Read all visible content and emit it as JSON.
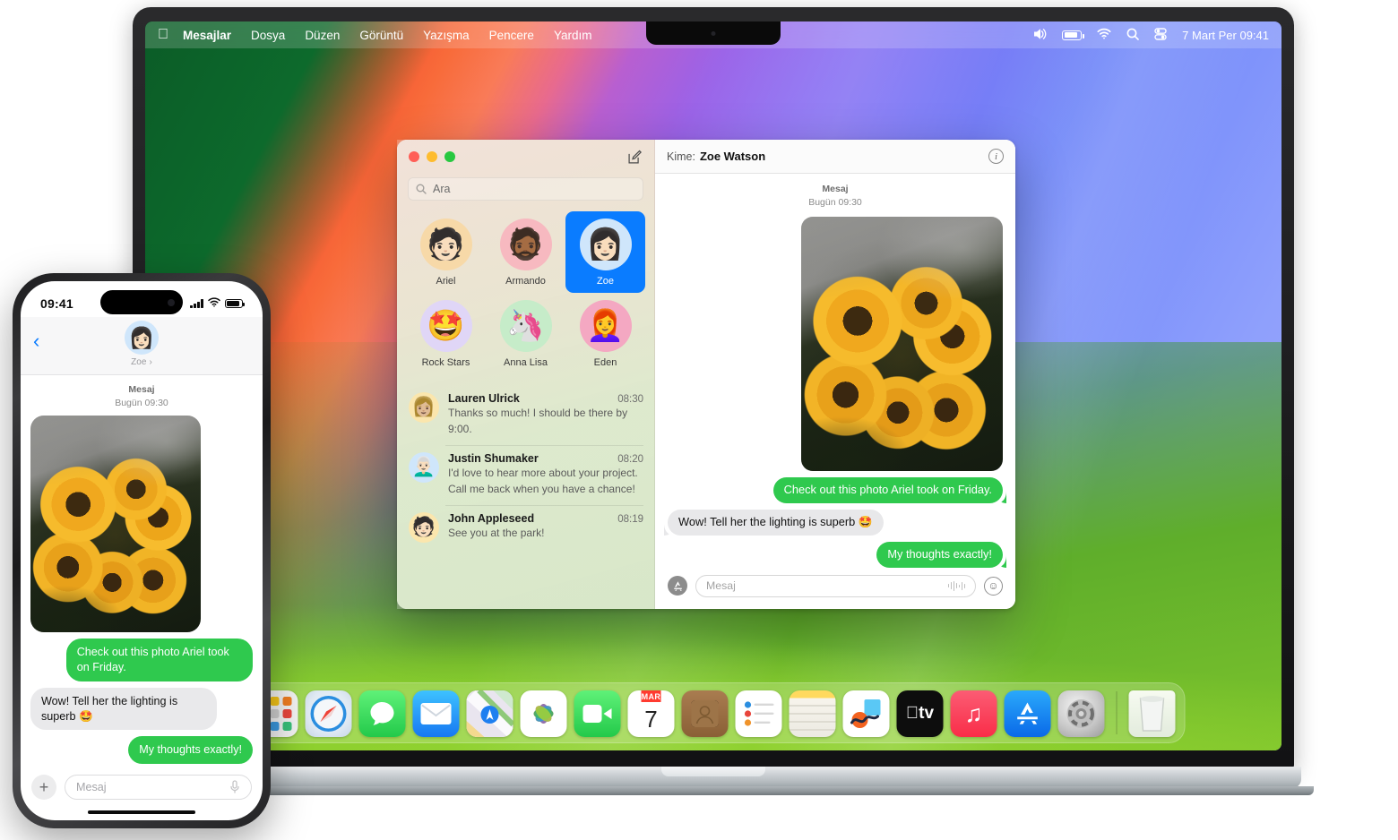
{
  "menubar": {
    "apple_icon": "apple-icon",
    "items": [
      {
        "label": "Mesajlar",
        "bold": true
      },
      {
        "label": "Dosya",
        "bold": false
      },
      {
        "label": "Düzen",
        "bold": false
      },
      {
        "label": "Görüntü",
        "bold": false
      },
      {
        "label": "Yazışma",
        "bold": false
      },
      {
        "label": "Pencere",
        "bold": false
      },
      {
        "label": "Yardım",
        "bold": false
      }
    ],
    "status_icons": [
      "volume-icon",
      "battery-icon",
      "wifi-icon",
      "search-icon",
      "control-center-icon"
    ],
    "clock": "7 Mart Per  09:41"
  },
  "messages_window": {
    "traffic_lights": [
      "close-button",
      "minimize-button",
      "zoom-button"
    ],
    "compose_icon": "compose-icon",
    "search": {
      "placeholder": "Ara",
      "icon": "search-icon"
    },
    "pinned": [
      {
        "name": "Ariel",
        "emoji": "🧑🏻",
        "bg": "#f7d9a8",
        "selected": false
      },
      {
        "name": "Armando",
        "emoji": "🧔🏾",
        "bg": "#f7b9c0",
        "selected": false
      },
      {
        "name": "Zoe",
        "emoji": "👩🏻",
        "bg": "#cfe6fb",
        "selected": true
      },
      {
        "name": "Rock Stars",
        "emoji": "🤩",
        "bg": "#e0d6f7",
        "selected": false
      },
      {
        "name": "Anna Lisa",
        "emoji": "🦄",
        "bg": "#c6ecc9",
        "selected": false
      },
      {
        "name": "Eden",
        "emoji": "👩‍🦰",
        "bg": "#f4a8c2",
        "selected": false
      }
    ],
    "conversations": [
      {
        "name": "Lauren Ulrick",
        "time": "08:30",
        "preview": "Thanks so much! I should be there by 9:00.",
        "emoji": "👩🏼",
        "bg": "#fbe6ad"
      },
      {
        "name": "Justin Shumaker",
        "time": "08:20",
        "preview": "I'd love to hear more about your project.\nCall me back when you have a chance!",
        "emoji": "👨🏻‍🦳",
        "bg": "#cfe6fb"
      },
      {
        "name": "John Appleseed",
        "time": "08:19",
        "preview": "See you at the park!",
        "emoji": "🧑🏻",
        "bg": "#fbe6ad"
      }
    ],
    "header": {
      "to_label": "Kime:",
      "recipient": "Zoe Watson",
      "info_icon": "info-icon"
    },
    "thread": {
      "service": "Mesaj",
      "timestamp": "Bugün 09:30",
      "attachment_alt": "sunflowers-photo",
      "messages": [
        {
          "text": "Check out this photo Ariel took on Friday.",
          "side": "out"
        },
        {
          "text": "Wow! Tell her the lighting is superb 🤩",
          "side": "in"
        },
        {
          "text": "My thoughts exactly!",
          "side": "out"
        }
      ]
    },
    "composer": {
      "apps_icon": "app-store-icon",
      "placeholder": "Mesaj",
      "audio_icon": "audio-waveform-icon",
      "emoji_icon": "emoji-icon"
    }
  },
  "dock": {
    "items": [
      {
        "name": "launchpad",
        "label": "Launchpad"
      },
      {
        "name": "safari",
        "label": "Safari"
      },
      {
        "name": "messages",
        "label": "Mesajlar"
      },
      {
        "name": "mail",
        "label": "Mail"
      },
      {
        "name": "maps",
        "label": "Haritalar"
      },
      {
        "name": "photos",
        "label": "Fotoğraflar"
      },
      {
        "name": "facetime",
        "label": "FaceTime"
      },
      {
        "name": "calendar",
        "label": "Takvim",
        "month": "MAR",
        "day": "7"
      },
      {
        "name": "contacts",
        "label": "Kişiler"
      },
      {
        "name": "reminders",
        "label": "Anımsatıcılar"
      },
      {
        "name": "notes",
        "label": "Notlar"
      },
      {
        "name": "freeform",
        "label": "Freeform"
      },
      {
        "name": "apple-tv",
        "label": "TV"
      },
      {
        "name": "music",
        "label": "Müzik"
      },
      {
        "name": "app-store",
        "label": "App Store"
      },
      {
        "name": "system-settings",
        "label": "Sistem Ayarları"
      },
      {
        "name": "trash",
        "label": "Çöp Sepeti"
      }
    ]
  },
  "iphone": {
    "status": {
      "time": "09:41",
      "icons": [
        "cellular-icon",
        "wifi-icon",
        "battery-icon"
      ]
    },
    "navbar": {
      "back_icon": "back-chevron-icon",
      "peer_name": "Zoe",
      "peer_chevron": "›"
    },
    "thread": {
      "service": "Mesaj",
      "timestamp": "Bugün 09:30",
      "attachment_alt": "sunflowers-photo",
      "messages": [
        {
          "text": "Check out this photo Ariel took on Friday.",
          "side": "out"
        },
        {
          "text": "Wow! Tell her the lighting is superb 🤩",
          "side": "in"
        },
        {
          "text": "My thoughts exactly!",
          "side": "out"
        }
      ]
    },
    "composer": {
      "plus_icon": "plus-icon",
      "placeholder": "Mesaj",
      "mic_icon": "microphone-icon"
    }
  },
  "colors": {
    "bubble_sent": "#2fc94e",
    "bubble_received": "#e8e8ea",
    "accent_blue": "#0a7cff",
    "ios_blue": "#0a7cff"
  }
}
